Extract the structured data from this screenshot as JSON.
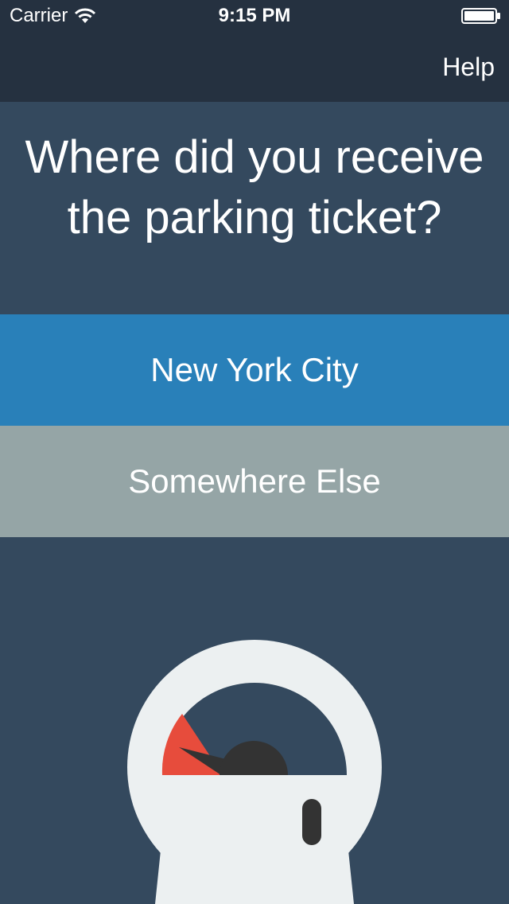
{
  "status_bar": {
    "carrier": "Carrier",
    "time": "9:15 PM",
    "wifi_icon": "wifi-icon",
    "battery_icon": "battery-icon"
  },
  "nav": {
    "help_label": "Help"
  },
  "question": {
    "line1": "Where did you receive",
    "line2": "the parking ticket?"
  },
  "options": [
    {
      "label": "New York City",
      "color": "#2980b9"
    },
    {
      "label": "Somewhere Else",
      "color": "#95a5a6"
    }
  ],
  "colors": {
    "background": "#34495e",
    "topbar": "#253140",
    "meter_body": "#ecf0f1",
    "meter_red": "#e74c3c",
    "meter_dark": "#333333"
  },
  "illustration": {
    "icon": "parking-meter-icon"
  }
}
